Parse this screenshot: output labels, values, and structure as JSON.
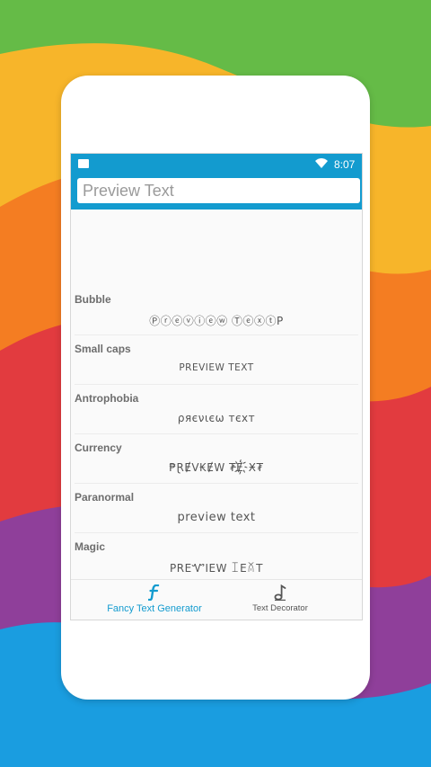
{
  "status_bar": {
    "time": "8:07"
  },
  "search": {
    "placeholder": "Preview Text",
    "value": ""
  },
  "styles": [
    {
      "name": "Bubble",
      "sample": "Ⓟⓡⓔⓥⓘⓔⓦ ⓉⓔⓧⓣΡ"
    },
    {
      "name": "Small caps",
      "sample": "PREVIEW TEXT"
    },
    {
      "name": "Antrophobia",
      "sample": "ρяєνιєω тєхт"
    },
    {
      "name": "Currency",
      "sample": "₱ⱤɆV₭ɆW ₮Ɇ҉Ӿ₮"
    },
    {
      "name": "Paranormal",
      "sample": "preview text"
    },
    {
      "name": "Magic",
      "sample": "PREᏉIEW ꀤEꊼT"
    }
  ],
  "bottom_nav": {
    "fancy_label": "Fancy Text Generator",
    "decorator_label": "Text Decorator"
  },
  "colors": {
    "accent": "#139bcf"
  }
}
